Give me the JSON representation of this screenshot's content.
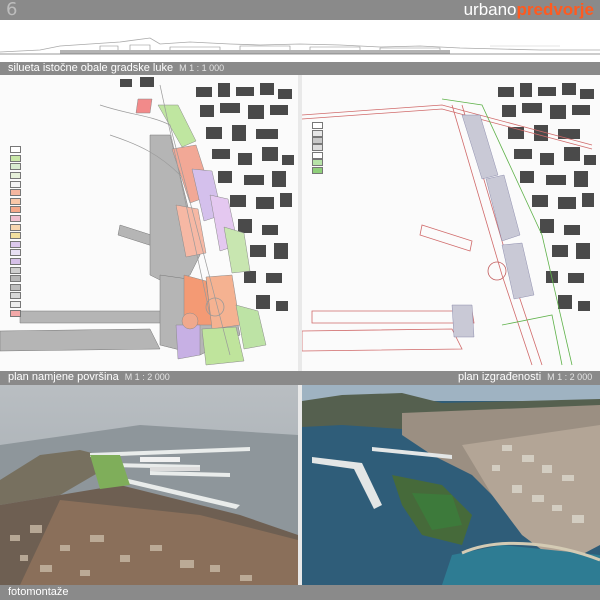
{
  "header": {
    "page_number": "6",
    "brand_part1": "urbano",
    "brand_part2": "predvorje"
  },
  "silhouette": {
    "title": "silueta istočne obale gradske luke",
    "scale": "M 1 : 1 000"
  },
  "left_plan": {
    "title": "plan namjene površina",
    "scale": "M 1 : 2 000",
    "legend_colors": [
      "#ffffff",
      "#c9e7a8",
      "#d8ead0",
      "#e6f0d9",
      "#f3f3f3",
      "#f6b7a0",
      "#f9c7a8",
      "#f4a88a",
      "#f0c0d0",
      "#f7d6b0",
      "#f2e0a0",
      "#dcc8ec",
      "#e8e0f3",
      "#d6c0e8",
      "#cfcfcf",
      "#b8b8b8",
      "#bdbdbd",
      "#d9d9d9",
      "#ececec",
      "#f2a8a8"
    ]
  },
  "right_plan": {
    "title": "plan izgrađenosti",
    "scale": "M 1 : 2 000",
    "legend_colors": [
      "#ffffff",
      "#e6e6e6",
      "#c8c8c8",
      "#dcdcdc",
      "#ffffff",
      "#b7e3a8",
      "#8fcf7a"
    ]
  },
  "photos": {
    "title": "fotomontaže"
  }
}
